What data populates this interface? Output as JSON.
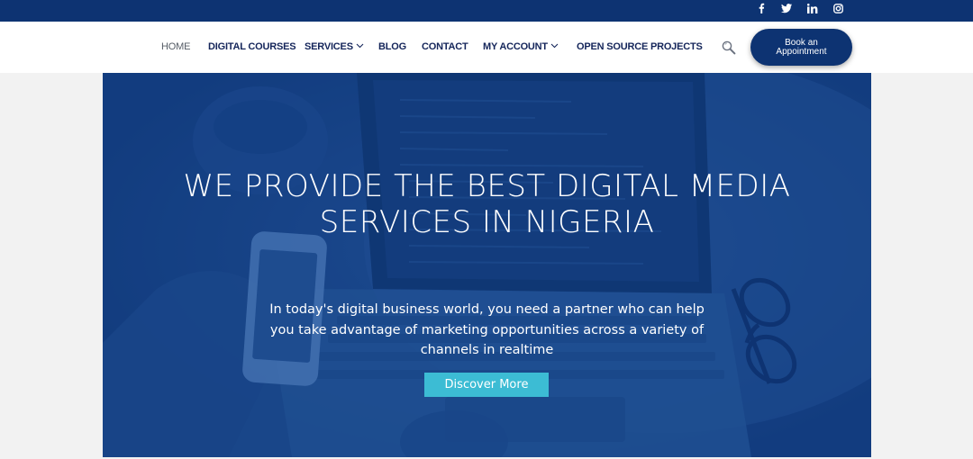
{
  "social": {
    "icons": [
      "facebook-icon",
      "twitter-icon",
      "linkedin-icon",
      "instagram-icon"
    ]
  },
  "nav": {
    "home": "HOME",
    "digital_courses": "DIGITAL COURSES",
    "services": "SERVICES",
    "blog": "BLOG",
    "contact": "CONTACT",
    "my_account": "MY ACCOUNT",
    "open_source": "OPEN SOURCE PROJECTS",
    "search_icon": "search-icon",
    "book_label": "Book an Appointment"
  },
  "hero": {
    "title": "WE PROVIDE THE BEST DIGITAL MEDIA SERVICES IN NIGERIA",
    "text": "In today's digital business world, you need a partner who can help you take advantage of marketing opportunities across a variety of channels in realtime",
    "button": "Discover More"
  },
  "colors": {
    "brand": "#0d3372",
    "accent": "#3cbcd4",
    "hero_overlay": "#1c4a8a"
  }
}
